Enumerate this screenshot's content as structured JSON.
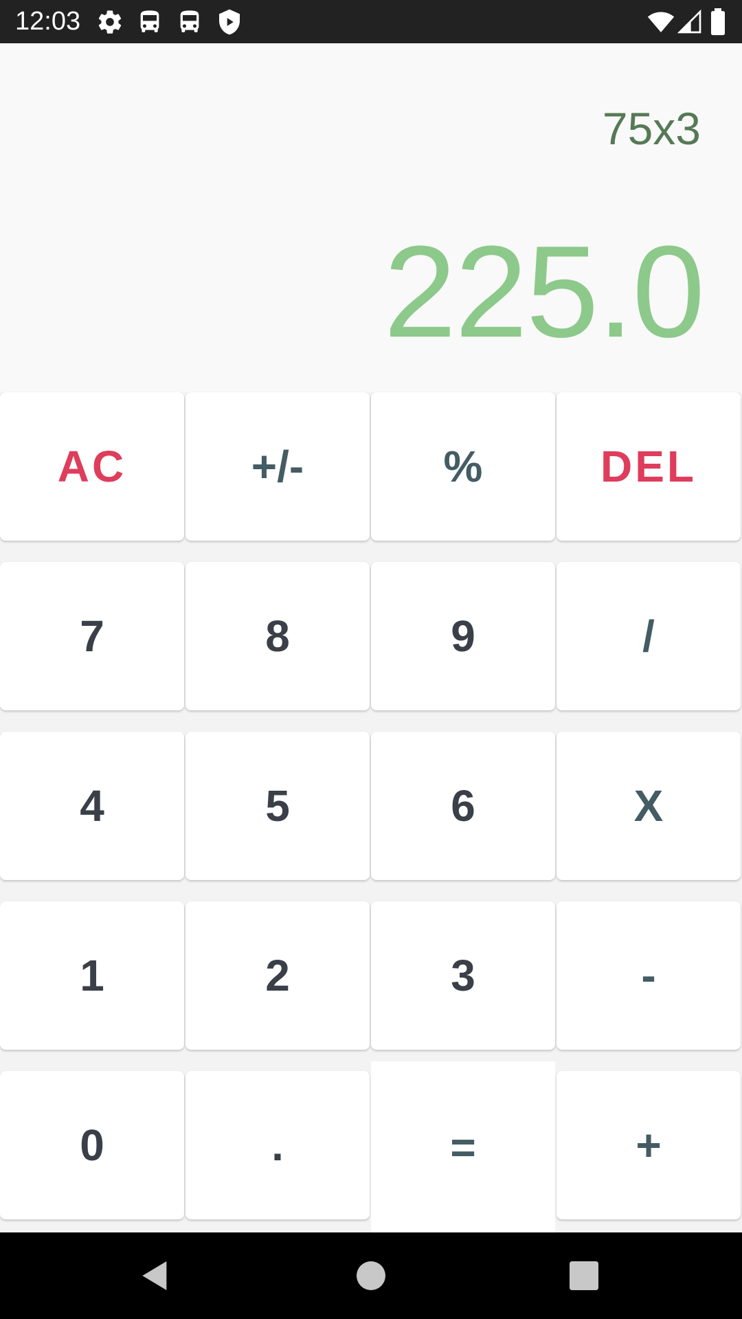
{
  "status_bar": {
    "time": "12:03",
    "left_icons": [
      "gear-icon",
      "bus-icon",
      "bus-icon",
      "shield-play-icon"
    ],
    "right_icons": [
      "wifi-icon",
      "cell-signal-icon",
      "battery-icon"
    ]
  },
  "display": {
    "expression": "75x3",
    "result": "225.0"
  },
  "keypad": {
    "rows": [
      [
        "AC",
        "+/-",
        "%",
        "DEL"
      ],
      [
        "7",
        "8",
        "9",
        "/"
      ],
      [
        "4",
        "5",
        "6",
        "X"
      ],
      [
        "1",
        "2",
        "3",
        "-"
      ],
      [
        "0",
        ".",
        "=",
        "+"
      ]
    ]
  },
  "nav_bar": {
    "buttons": [
      "back-icon",
      "home-icon",
      "recents-icon"
    ]
  },
  "colors": {
    "status_bar_bg": "#222222",
    "display_bg": "#f9f9f9",
    "expression_text": "#557a55",
    "result_text": "#8cc98a",
    "danger_key_text": "#de3d5c",
    "operator_key_text": "#445c64",
    "digit_key_text": "#3a3f48",
    "nav_bar_bg": "#000000"
  }
}
